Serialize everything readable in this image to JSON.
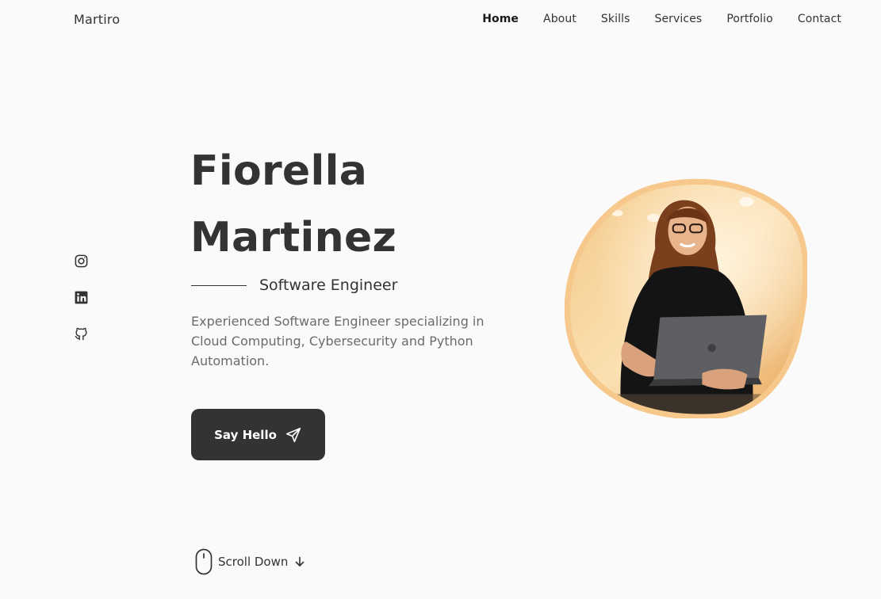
{
  "brand": "Martiro",
  "nav": [
    {
      "label": "Home",
      "active": true
    },
    {
      "label": "About"
    },
    {
      "label": "Skills"
    },
    {
      "label": "Services"
    },
    {
      "label": "Portfolio"
    },
    {
      "label": "Contact"
    }
  ],
  "social": [
    {
      "icon": "instagram-icon"
    },
    {
      "icon": "linkedin-icon"
    },
    {
      "icon": "github-icon"
    }
  ],
  "hero": {
    "name_first": "Fiorella",
    "name_last": "Martinez",
    "subtitle": "Software Engineer",
    "description": "Experienced Software Engineer specializing in Cloud Computing, Cybersecurity and Python Automation.",
    "cta_label": "Say Hello",
    "cta_icon": "send-icon"
  },
  "scroll": {
    "label": "Scroll Down",
    "icons": [
      "mouse-icon",
      "arrow-down-icon"
    ]
  },
  "colors": {
    "background": "#fafafa",
    "text": "#333333",
    "muted": "#6b6b6b",
    "button": "#333333",
    "blob_border": "#f6c88c"
  }
}
